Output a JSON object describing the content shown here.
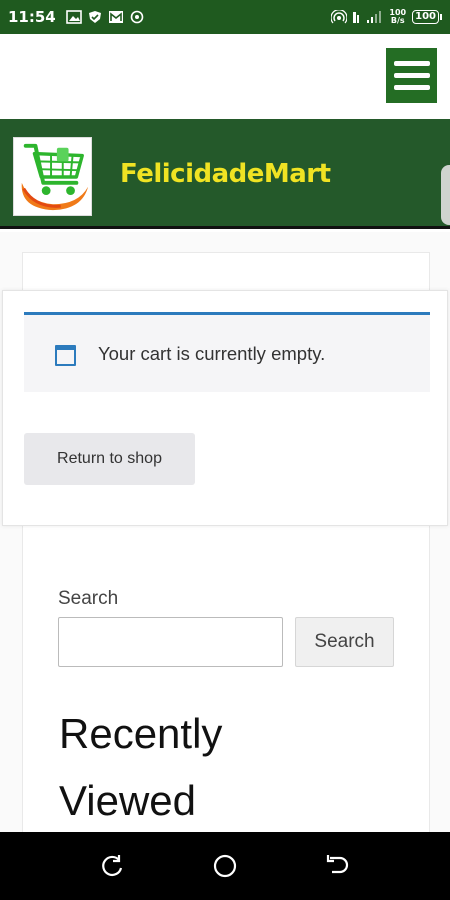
{
  "status_bar": {
    "time": "11:54",
    "net_speed_value": "100",
    "net_speed_unit": "B/s",
    "battery": "100",
    "icons": [
      "gallery-icon",
      "shield-icon",
      "mail-icon",
      "location-icon",
      "hotspot-icon",
      "signal-icon"
    ]
  },
  "header": {
    "menu_icon": "hamburger-menu-icon"
  },
  "brand": {
    "name": "FelicidadeMart",
    "logo_icon": "shopping-cart-logo",
    "name_color": "#f0e323",
    "bar_color": "#24592a"
  },
  "cart": {
    "notice_text": "Your cart is currently empty.",
    "notice_icon": "window-info-icon",
    "return_button_label": "Return to shop",
    "accent_color": "#2c7bbd"
  },
  "search": {
    "label": "Search",
    "input_value": "",
    "button_label": "Search"
  },
  "recently_viewed": {
    "title": "Recently Viewed"
  },
  "nav_bar": {
    "icons": [
      "recent-apps-icon",
      "home-icon",
      "back-icon"
    ]
  }
}
